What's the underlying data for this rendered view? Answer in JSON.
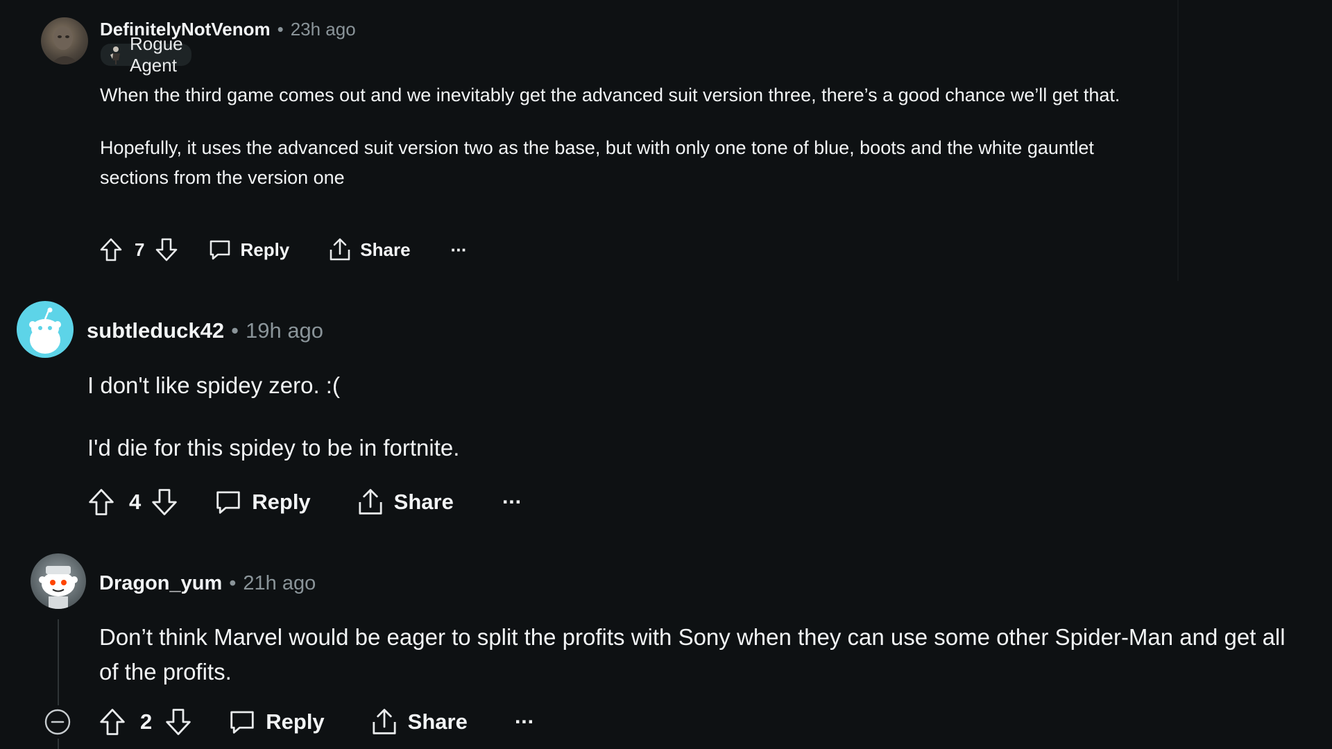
{
  "comments": [
    {
      "username": "DefinitelyNotVenom",
      "separator": "•",
      "time": "23h ago",
      "flair": "Rogue Agent",
      "paragraphs": [
        "When the third game comes out and we inevitably get the advanced suit version three, there’s a good chance we’ll get that.",
        "Hopefully, it uses the advanced suit version two as the base, but with only one tone of blue, boots and the white gauntlet sections from the version one"
      ],
      "votes": "7",
      "reply_label": "Reply",
      "share_label": "Share",
      "more_label": "···"
    },
    {
      "username": "subtleduck42",
      "separator": "•",
      "time": "19h ago",
      "paragraphs": [
        "I don't like spidey zero. :(",
        "I'd die for this spidey to be in fortnite."
      ],
      "votes": "4",
      "reply_label": "Reply",
      "share_label": "Share",
      "more_label": "···"
    },
    {
      "username": "Dragon_yum",
      "separator": "•",
      "time": "21h ago",
      "paragraphs": [
        "Don’t think Marvel would be eager to split the profits with Sony when they can use some other Spider-Man and get all of the profits."
      ],
      "votes": "2",
      "reply_label": "Reply",
      "share_label": "Share",
      "more_label": "···"
    }
  ],
  "icons": {
    "upvote": "upvote-icon",
    "downvote": "downvote-icon",
    "reply": "comment-bubble-icon",
    "share": "share-icon",
    "collapse": "collapse-minus-icon",
    "more": "more-options-icon"
  },
  "colors": {
    "background": "#0e1113",
    "text": "#f2f4f5",
    "muted": "#8a9499",
    "thread_line": "#2f3537",
    "snoo_avatar": "#5dd4e8"
  }
}
